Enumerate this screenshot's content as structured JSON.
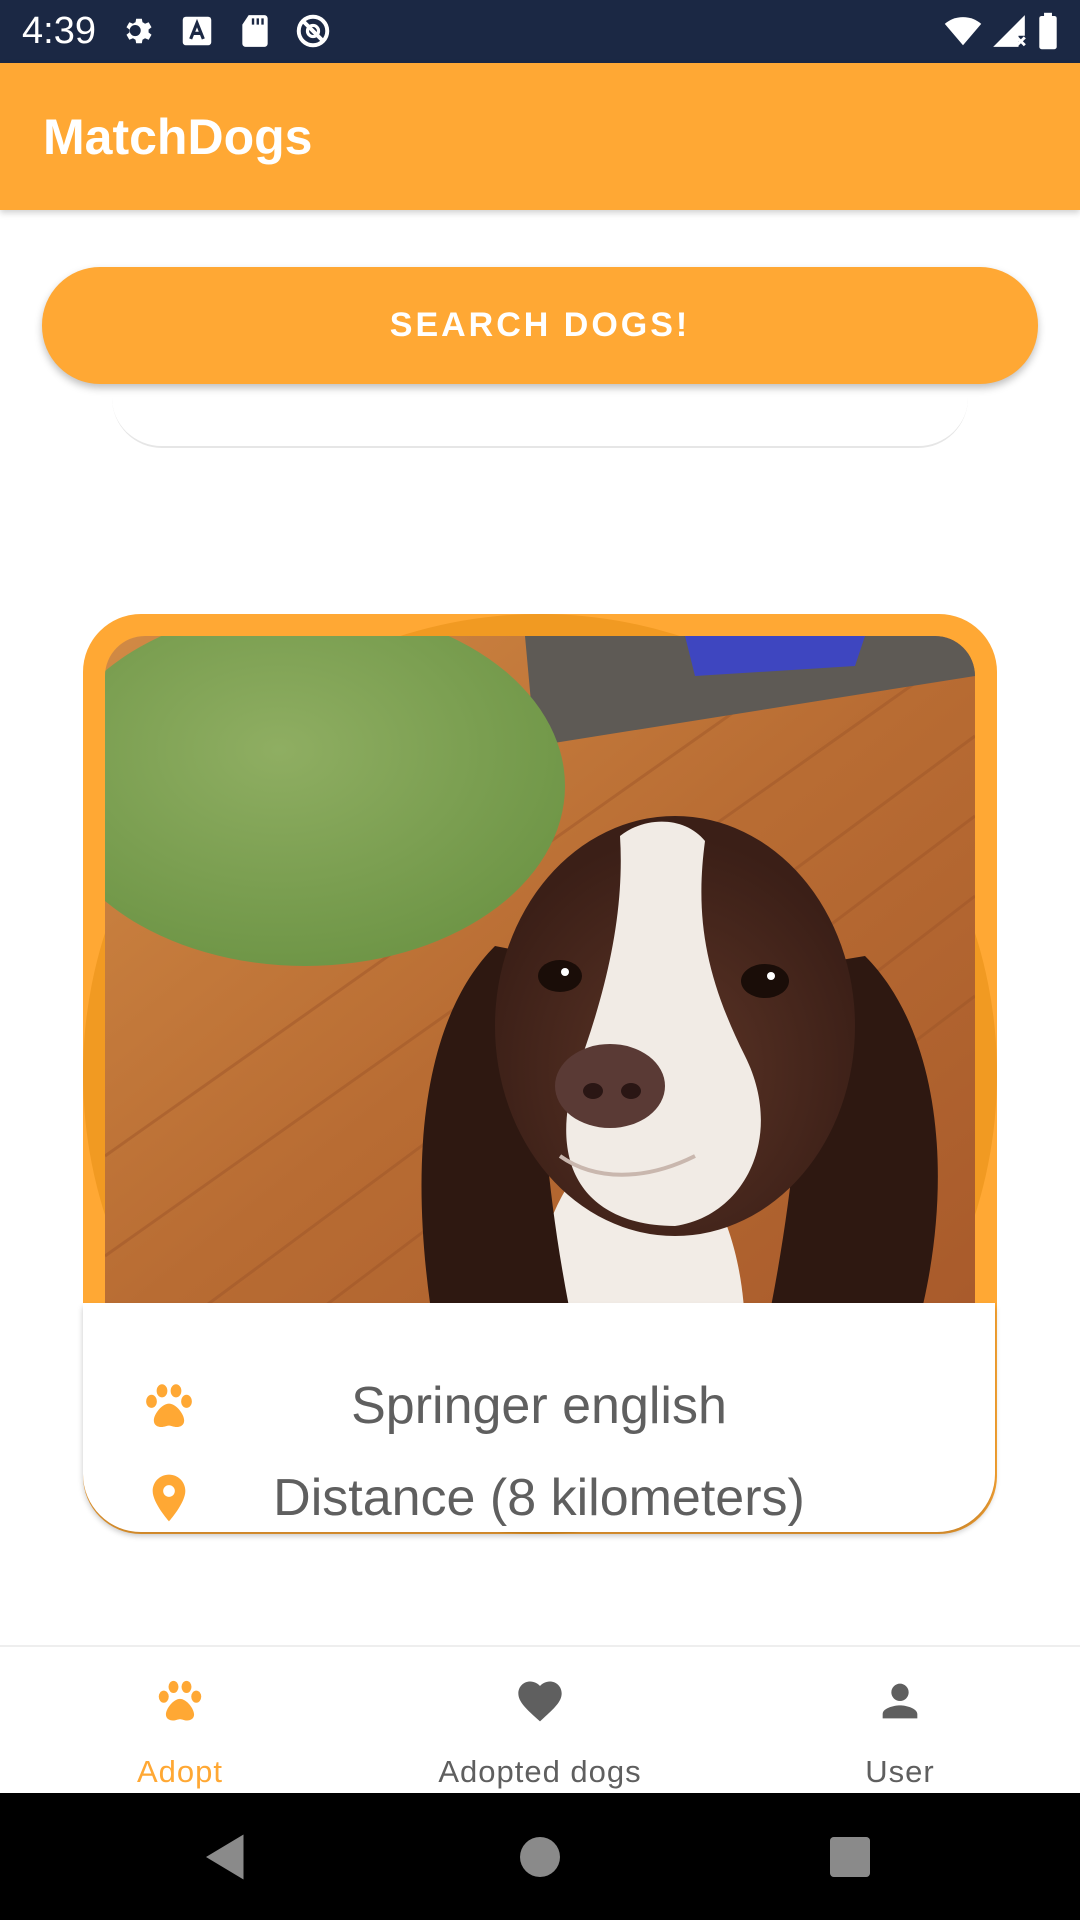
{
  "status_bar": {
    "time": "4:39",
    "left_icons": [
      "gear-icon",
      "font-a-icon",
      "sd-card-icon",
      "no-disturb-icon"
    ],
    "right_icons": [
      "wifi-icon",
      "cell-signal-icon",
      "battery-icon"
    ]
  },
  "app_bar": {
    "title": "MatchDogs"
  },
  "search": {
    "label": "SEARCH DOGS!"
  },
  "dog_card": {
    "breed": "Springer english",
    "distance": "Distance (8 kilometers)",
    "breed_icon": "paw-icon",
    "distance_icon": "location-pin-icon"
  },
  "bottom_nav": {
    "items": [
      {
        "label": "Adopt",
        "icon": "paw-icon",
        "active": true
      },
      {
        "label": "Adopted dogs",
        "icon": "heart-icon",
        "active": false
      },
      {
        "label": "User",
        "icon": "person-icon",
        "active": false
      }
    ]
  },
  "colors": {
    "accent": "#ffa834",
    "status_bar": "#1b2844",
    "text_secondary": "#5f5f5f"
  }
}
